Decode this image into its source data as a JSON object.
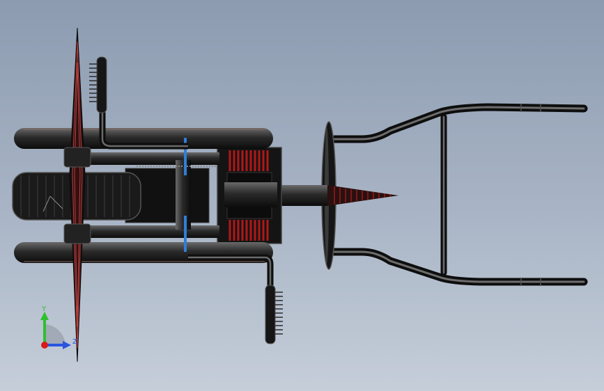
{
  "viewport": {
    "background_top": "#8c9bb0",
    "background_bottom": "#c5ced9"
  },
  "model": {
    "body_color": "#1c1c1c",
    "edge_color": "#4a4a4a",
    "spring_color": "#b01818",
    "blade_accent": "#c04040",
    "hose_color": "#2f7fd8"
  },
  "triad": {
    "y_label": "Y",
    "z_label": "Z",
    "y_color": "#2fbf2f",
    "z_color": "#2a55e0",
    "x_color": "#d81a1a"
  }
}
